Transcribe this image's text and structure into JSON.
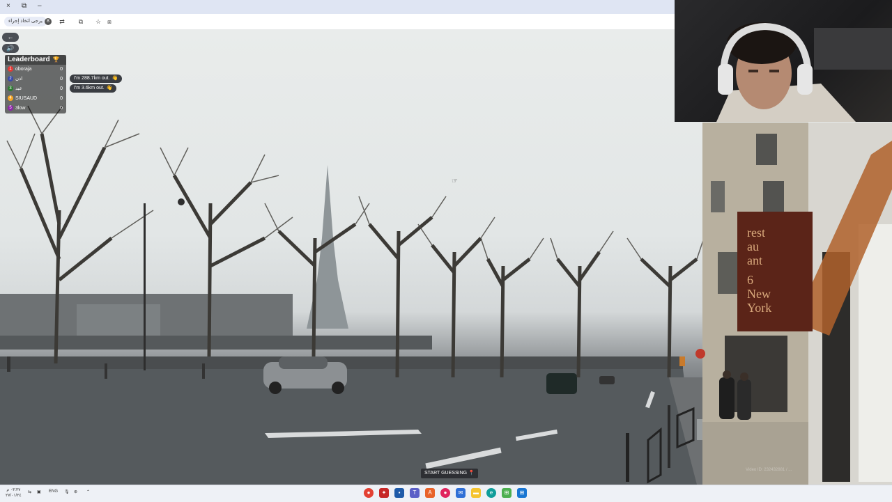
{
  "browser": {
    "window_controls": [
      "×",
      "⧉",
      "–"
    ],
    "profile_label": "يرجى اتخاذ إجراء",
    "ext_badge": "8"
  },
  "game": {
    "leaderboard": {
      "title": "Leaderboard",
      "players": [
        {
          "rank": "1",
          "name": "oboraja",
          "score": "0",
          "color": "#e53935"
        },
        {
          "rank": "2",
          "name": "اذن",
          "score": "0",
          "color": "#3949ab"
        },
        {
          "rank": "3",
          "name": "عبد",
          "score": "0",
          "color": "#2e7d32"
        },
        {
          "rank": "4",
          "name": "SIUSAUD",
          "score": "0",
          "color": "#f9a825"
        },
        {
          "rank": "5",
          "name": "3low",
          "score": "0",
          "color": "#8e24aa"
        }
      ]
    },
    "bubbles": [
      {
        "text": "I'm 288.7km out."
      },
      {
        "text": "I'm 3.6km out."
      }
    ],
    "start_guessing": "START GUESSING",
    "scene_sign": [
      "rest",
      "au",
      "ant",
      "6",
      "New",
      "York"
    ],
    "watermark": "Video ID: 232432881 / ..."
  },
  "taskbar": {
    "clock_time": "٠٣:٣٧ م",
    "clock_date": "٢٧/٠١/٢٤",
    "language": "ENG"
  },
  "colors": {
    "sign": "#5b2418",
    "awning": "#b0612c"
  }
}
